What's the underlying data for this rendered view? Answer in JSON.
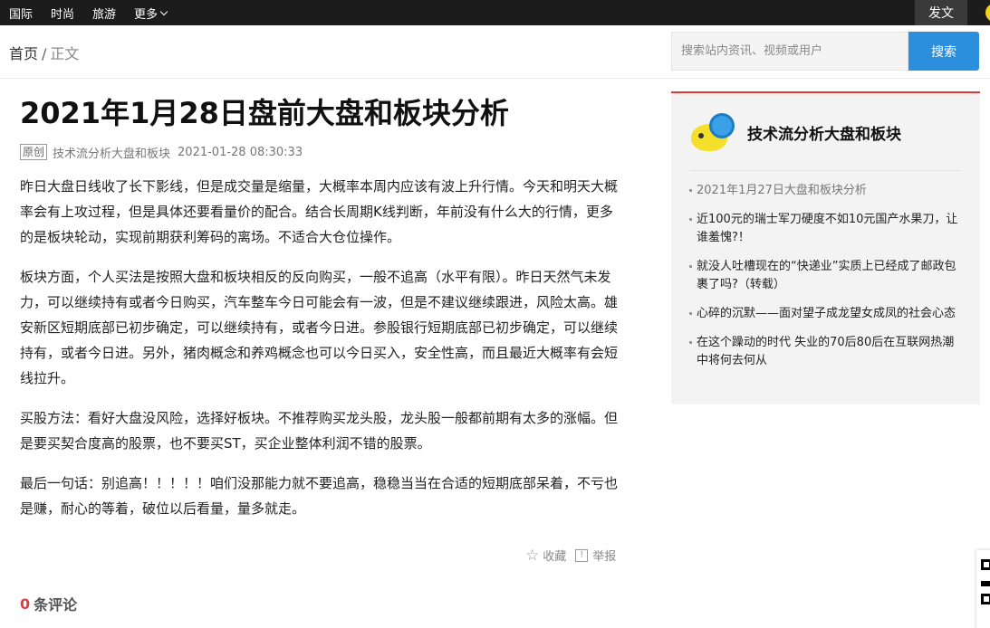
{
  "topnav": {
    "items": [
      "国际",
      "时尚",
      "旅游",
      "更多"
    ],
    "post_label": "发文"
  },
  "breadcrumb": {
    "home": "首页",
    "separator": "/",
    "current": "正文"
  },
  "search": {
    "placeholder": "搜索站内资讯、视频或用户",
    "button_label": "搜索"
  },
  "article": {
    "title": "2021年1月28日盘前大盘和板块分析",
    "badge": "原创",
    "author": "技术流分析大盘和板块",
    "datetime": "2021-01-28 08:30:33",
    "paragraphs": [
      "昨日大盘日线收了长下影线，但是成交量是缩量，大概率本周内应该有波上升行情。今天和明天大概率会有上攻过程，但是具体还要看量价的配合。结合长周期K线判断，年前没有什么大的行情，更多的是板块轮动，实现前期获利筹码的离场。不适合大仓位操作。",
      "板块方面，个人买法是按照大盘和板块相反的反向购买，一般不追高（水平有限）。昨日天然气未发力，可以继续持有或者今日购买，汽车整车今日可能会有一波，但是不建议继续跟进，风险太高。雄安新区短期底部已初步确定，可以继续持有，或者今日进。参股银行短期底部已初步确定，可以继续持有，或者今日进。另外，猪肉概念和养鸡概念也可以今日买入，安全性高，而且最近大概率有会短线拉升。",
      "买股方法：看好大盘没风险，选择好板块。不推荐购买龙头股，龙头股一般都前期有太多的涨幅。但是要买契合度高的股票，也不要买ST，买企业整体利润不错的股票。",
      "最后一句话：别追高！！！！！咱们没那能力就不要追高，稳稳当当在合适的短期底部呆着，不亏也是赚，耐心的等着，破位以后看量，量多就走。"
    ],
    "favorite_label": "收藏",
    "report_label": "举报"
  },
  "comments": {
    "count": "0",
    "label": "条评论"
  },
  "sidebar": {
    "author_name": "技术流分析大盘和板块",
    "articles": [
      "2021年1月27日大盘和板块分析",
      "近100元的瑞士军刀硬度不如10元国产水果刀，让谁羞愧?！",
      "就没人吐槽现在的“快递业”实质上已经成了邮政包裹了吗?（转载）",
      "心碎的沉默——面对望子成龙望女成凤的社会心态",
      "在这个躁动的时代 失业的70后80后在互联网热潮中将何去何从"
    ]
  },
  "colors": {
    "topbar": "#1c1c1c",
    "accent_blue": "#2b8fde",
    "accent_red": "#e23a3a"
  }
}
